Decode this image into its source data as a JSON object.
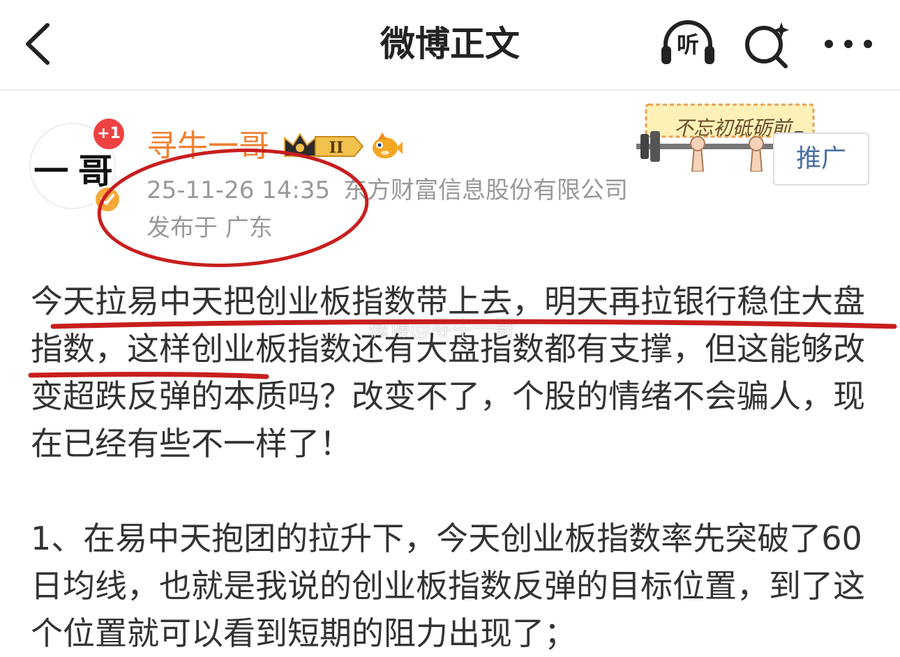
{
  "nav": {
    "title": "微博正文",
    "listen_label": "听",
    "icons": [
      "back-arrow-icon",
      "headphones-icon",
      "search-sparkle-icon",
      "more-dots-icon"
    ]
  },
  "author": {
    "avatar_text": "一 哥",
    "follow_badge": "+1",
    "name": "寻牛一哥",
    "level_badge": "II",
    "name_color": "#f08030"
  },
  "meta": {
    "time": "25-11-26 14:35",
    "source": "东方财富信息股份有限公司",
    "location": "发布于 广东"
  },
  "sticker": {
    "text": "不忘初砥砺前"
  },
  "promote": {
    "label": "推广"
  },
  "post": {
    "paragraph1": "今天拉易中天把创业板指数带上去，明天再拉银行稳住大盘指数，这样创业板指数还有大盘指数都有支撑，但这能够改变超跌反弹的本质吗？改变不了，个股的情绪不会骗人，现在已经有些不一样了！",
    "paragraph2": "1、在易中天抱团的拉升下，今天创业板指数率先突破了60日均线，也就是我说的创业板指数反弹的目标位置，到了这个位置就可以看到短期的阻力出现了；"
  },
  "watermark": "微博@寻牛一哥",
  "colors": {
    "annotation_red": "#c81e1e",
    "meta_gray": "#999999",
    "promote_blue": "#4a6fa0"
  }
}
